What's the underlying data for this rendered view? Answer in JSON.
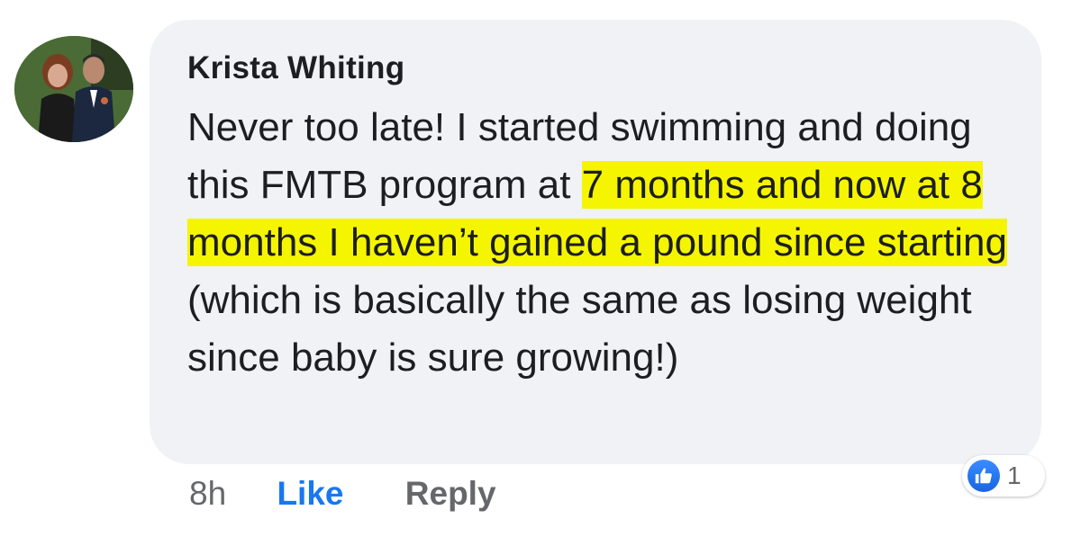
{
  "comment": {
    "author": "Krista Whiting",
    "segments": [
      {
        "text": "Never too late! I started swimming and doing this FMTB program at ",
        "highlighted": false
      },
      {
        "text": "7 months and now at 8 months I haven’t gained a pound since starting",
        "highlighted": true
      },
      {
        "text": " (which is basically the same as losing weight since baby is sure growing!)",
        "highlighted": false
      }
    ],
    "highlight_color": "#f5f500",
    "timestamp": "8h",
    "like_label": "Like",
    "reply_label": "Reply",
    "reaction_count": "1",
    "reaction_icon": "thumbs-up-icon"
  },
  "colors": {
    "bubble": "#f0f2f5",
    "like_link": "#1877f2",
    "meta_text": "#65676b"
  }
}
